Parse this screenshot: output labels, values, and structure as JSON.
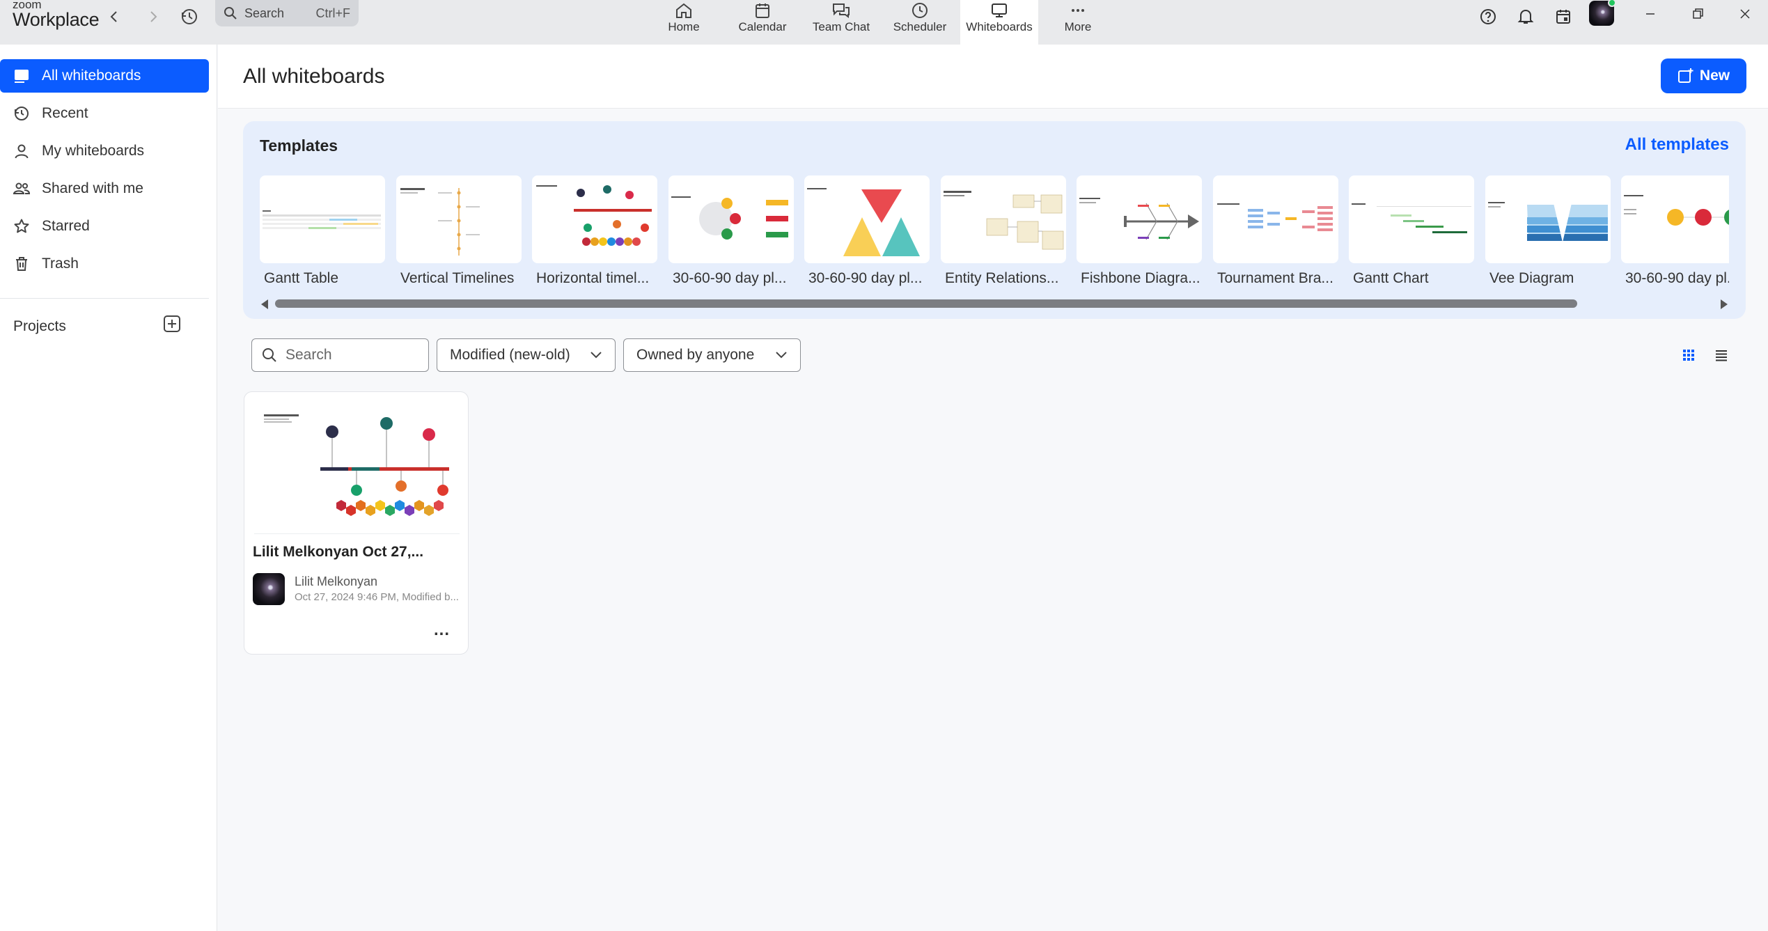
{
  "app": {
    "logo_small": "zoom",
    "logo_big": "Workplace"
  },
  "titlebar": {
    "search_label": "Search",
    "search_shortcut": "Ctrl+F",
    "nav": [
      {
        "label": "Home",
        "icon": "home-icon"
      },
      {
        "label": "Calendar",
        "icon": "calendar-icon"
      },
      {
        "label": "Team Chat",
        "icon": "chat-icon"
      },
      {
        "label": "Scheduler",
        "icon": "clock-icon"
      },
      {
        "label": "Whiteboards",
        "icon": "whiteboard-icon",
        "active": true
      },
      {
        "label": "More",
        "icon": "more-icon"
      }
    ]
  },
  "sidebar": {
    "items": [
      {
        "label": "All whiteboards",
        "icon": "whiteboard-icon",
        "active": true
      },
      {
        "label": "Recent",
        "icon": "history-icon"
      },
      {
        "label": "My whiteboards",
        "icon": "person-icon"
      },
      {
        "label": "Shared with me",
        "icon": "people-icon"
      },
      {
        "label": "Starred",
        "icon": "star-icon"
      },
      {
        "label": "Trash",
        "icon": "trash-icon"
      }
    ],
    "projects_label": "Projects"
  },
  "header": {
    "title": "All whiteboards",
    "new_label": "New"
  },
  "templates": {
    "title": "Templates",
    "all_label": "All templates",
    "items": [
      {
        "name": "Gantt Table"
      },
      {
        "name": "Vertical Timelines"
      },
      {
        "name": "Horizontal timel..."
      },
      {
        "name": "30-60-90 day pl..."
      },
      {
        "name": "30-60-90 day pl..."
      },
      {
        "name": "Entity Relations..."
      },
      {
        "name": "Fishbone Diagra..."
      },
      {
        "name": "Tournament Bra..."
      },
      {
        "name": "Gantt Chart"
      },
      {
        "name": "Vee Diagram"
      },
      {
        "name": "30-60-90 day pl..."
      }
    ]
  },
  "filters": {
    "search_placeholder": "Search",
    "sort_value": "Modified (new-old)",
    "owner_value": "Owned by anyone"
  },
  "boards": [
    {
      "title": "Lilit Melkonyan Oct 27,...",
      "owner": "Lilit Melkonyan",
      "meta": "Oct 27, 2024 9:46 PM, Modified b...",
      "more": "..."
    }
  ],
  "colors": {
    "accent": "#0b5cff",
    "panel": "#e6eefc"
  }
}
